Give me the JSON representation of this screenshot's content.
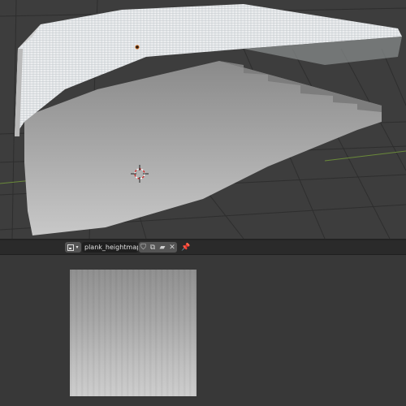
{
  "viewport": {
    "grid_color": "#2f2f2f",
    "mesh_light": "#e6e8ea",
    "mesh_shadow": "#9c9c9c",
    "x_axis_color": "#6a8a3a"
  },
  "image_editor": {
    "header": {
      "editor_type_icon": "image-editor-icon",
      "image_name": "plank_heightmap_st..."
    },
    "header_icons": [
      "shield-icon",
      "duplicate-icon",
      "folder-icon",
      "close-icon",
      "pin-icon"
    ],
    "image_name_full_hidden": ""
  }
}
